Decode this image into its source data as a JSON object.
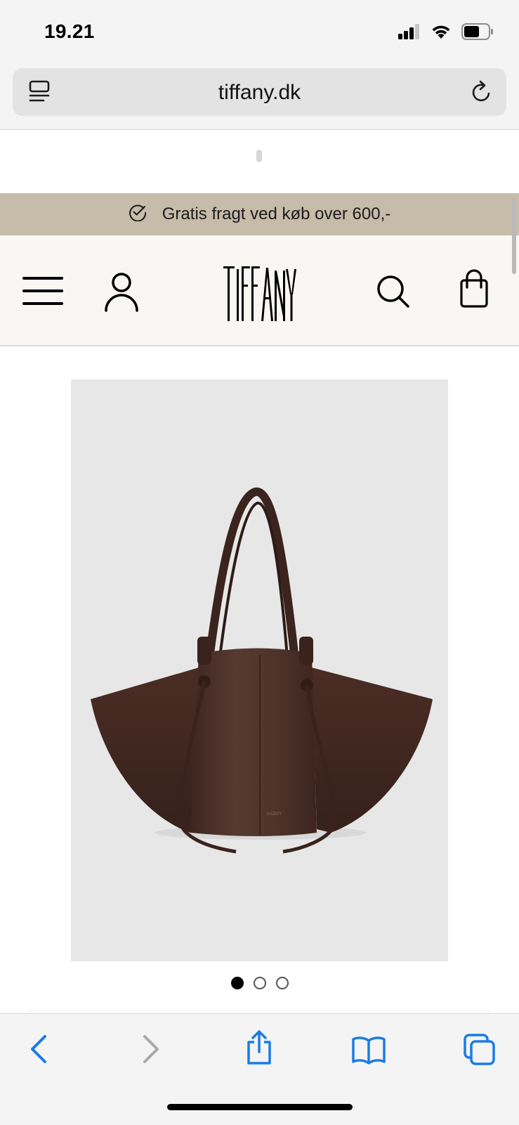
{
  "status_bar": {
    "time": "19.21",
    "icons": [
      "cellular-signal-icon",
      "wifi-icon",
      "battery-icon"
    ]
  },
  "browser": {
    "url": "tiffany.dk",
    "left_icon": "reader-view-icon",
    "right_icon": "reload-icon"
  },
  "promo": {
    "icon": "check-circle-icon",
    "text": "Gratis fragt ved køb over 600,-"
  },
  "header": {
    "menu_icon": "hamburger-menu-icon",
    "account_icon": "user-icon",
    "logo": "TIFFANY",
    "search_icon": "search-icon",
    "cart_icon": "shopping-bag-icon"
  },
  "product": {
    "image": "brown-leather-tote-bag",
    "image_label": "YUZEFI",
    "carousel": {
      "count": 3,
      "active_index": 0
    }
  },
  "toolbar": {
    "items": [
      "back-icon",
      "forward-icon",
      "share-icon",
      "bookmarks-icon",
      "tabs-icon"
    ]
  },
  "colors": {
    "promo_bg": "#c7bba9",
    "header_bg": "#f8f7f4",
    "image_bg": "#e7e7e7",
    "bag_brown": "#4a2f27",
    "ios_blue": "#1a7ce4"
  }
}
